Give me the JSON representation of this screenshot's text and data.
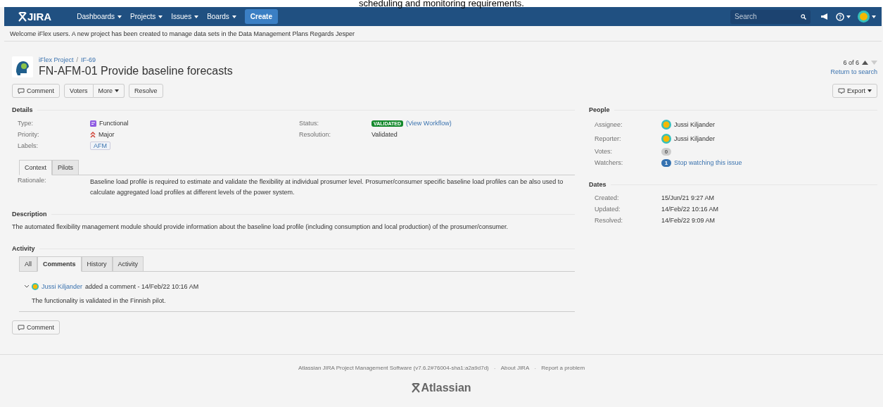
{
  "caption": "scheduling and monitoring requirements.",
  "nav": {
    "logo": "JIRA",
    "menus": [
      {
        "label": "Dashboards"
      },
      {
        "label": "Projects"
      },
      {
        "label": "Issues"
      },
      {
        "label": "Boards"
      }
    ],
    "create": "Create",
    "search": {
      "placeholder": "Search"
    }
  },
  "banner": "Welcome iFlex users. A new project has been created to manage data sets in the Data Management Plans Regards Jesper",
  "issue": {
    "project": "iFlex Project",
    "separator": "/",
    "key": "IF-69",
    "title": "FN-AFM-01 Provide baseline forecasts",
    "pager": "6 of 6",
    "return": "Return to search"
  },
  "toolbar": [
    {
      "label": "Comment",
      "kind": "icon"
    },
    {
      "label": "Voters",
      "kind": "group-start"
    },
    {
      "label": "More",
      "kind": "dropdown"
    },
    {
      "label": "Resolve",
      "kind": "plain"
    }
  ],
  "export": "Export",
  "details": {
    "heading": "Details",
    "left": [
      {
        "label": "Type:",
        "value": "Functional",
        "kind": "type"
      },
      {
        "label": "Priority:",
        "value": "Major",
        "kind": "priority"
      },
      {
        "label": "Labels:",
        "value": "AFM",
        "kind": "label"
      }
    ],
    "right": [
      {
        "label": "Status:",
        "value": "VALIDATED",
        "link": "(View Workflow)",
        "kind": "status"
      },
      {
        "label": "Resolution:",
        "value": "Validated",
        "kind": "text"
      }
    ]
  },
  "field_tabs": [
    {
      "label": "Context",
      "selected": true
    },
    {
      "label": "Pilots",
      "selected": false
    }
  ],
  "rationale": {
    "label": "Rationale:",
    "text": "Baseline load profile is required to estimate and validate the flexibility at individual prosumer level. Prosumer/consumer specific baseline load profiles can be also used to calculate aggregated load profiles at different levels of the power system."
  },
  "description": {
    "heading": "Description",
    "text": "The automated flexibility management module should provide information about the baseline load profile (including consumption and local production) of the prosumer/consumer."
  },
  "activity": {
    "heading": "Activity",
    "tabs": [
      {
        "label": "All",
        "selected": false
      },
      {
        "label": "Comments",
        "selected": true
      },
      {
        "label": "History",
        "selected": false
      },
      {
        "label": "Activity",
        "selected": false
      }
    ],
    "comment": {
      "author": "Jussi Kiljander",
      "meta": "added a comment - 14/Feb/22 10:16 AM",
      "body": "The functionality is validated in the Finnish pilot.",
      "expanded": true
    }
  },
  "comment_button": "Comment",
  "people": {
    "heading": "People",
    "rows": [
      {
        "label": "Assignee:",
        "value": "Jussi Kiljander",
        "kind": "user"
      },
      {
        "label": "Reporter:",
        "value": "Jussi Kiljander",
        "kind": "user"
      },
      {
        "label": "Votes:",
        "value": "0",
        "kind": "count"
      },
      {
        "label": "Watchers:",
        "value": "1",
        "link": "Stop watching this issue",
        "kind": "watch"
      }
    ]
  },
  "dates": {
    "heading": "Dates",
    "rows": [
      {
        "label": "Created:",
        "value": "15/Jun/21 9:27 AM"
      },
      {
        "label": "Updated:",
        "value": "14/Feb/22 10:16 AM"
      },
      {
        "label": "Resolved:",
        "value": "14/Feb/22 9:09 AM"
      }
    ]
  },
  "footer": {
    "links": [
      {
        "label": "Atlassian JIRA Project Management Software (v7.6.2#76004-sha1:a2a9d7d)"
      },
      {
        "label": "About JIRA"
      },
      {
        "label": "Report a problem"
      }
    ],
    "separator": "·",
    "brand": "Atlassian"
  }
}
